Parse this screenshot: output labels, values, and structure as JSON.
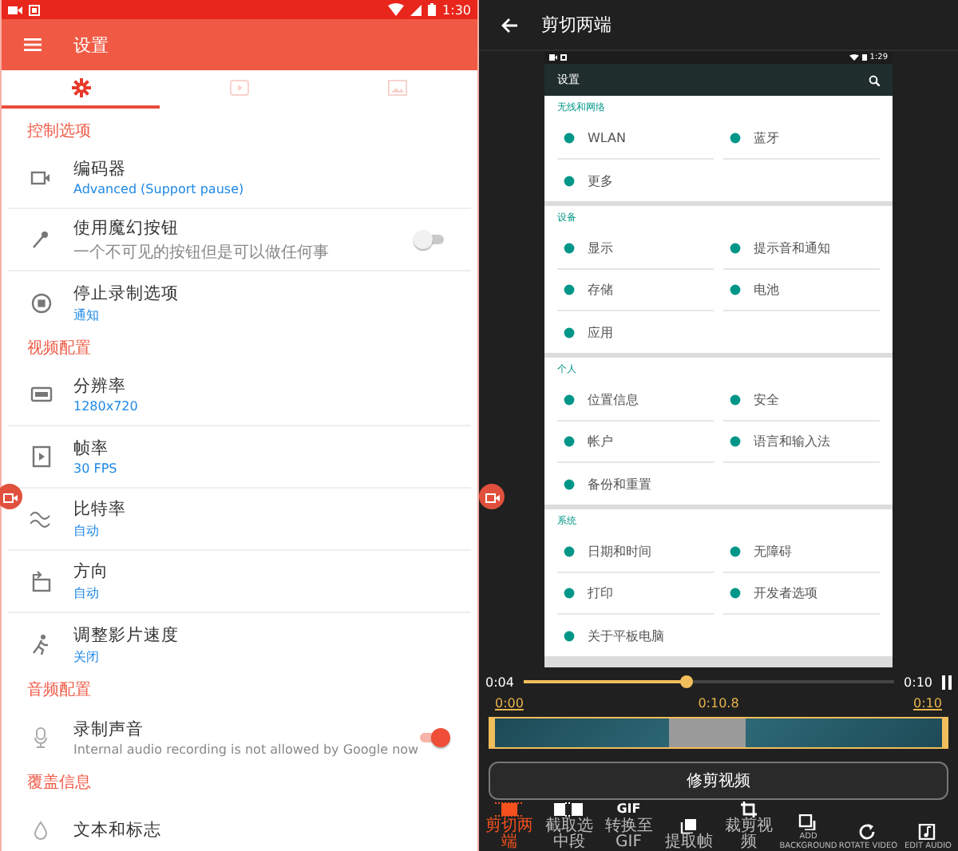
{
  "left_screen": {
    "status_bar": {
      "time": "1:30"
    },
    "app_bar": {
      "title": "设置"
    },
    "tabs": [
      {
        "selected": true
      },
      {
        "selected": false
      },
      {
        "selected": false
      }
    ],
    "sections": [
      {
        "header": "控制选项",
        "items": [
          {
            "kind": "value",
            "title": "编码器",
            "subtitle": "Advanced (Support pause)"
          },
          {
            "kind": "switch",
            "title": "使用魔幻按钮",
            "subtitle": "一个不可见的按钮但是可以做任何事",
            "on": false
          },
          {
            "kind": "value",
            "title": "停止录制选项",
            "subtitle": "通知"
          }
        ]
      },
      {
        "header": "视频配置",
        "items": [
          {
            "kind": "value",
            "title": "分辨率",
            "subtitle": "1280x720"
          },
          {
            "kind": "value",
            "title": "帧率",
            "subtitle": "30 FPS"
          },
          {
            "kind": "value",
            "title": "比特率",
            "subtitle": "自动"
          },
          {
            "kind": "value",
            "title": "方向",
            "subtitle": "自动"
          },
          {
            "kind": "value",
            "title": "调整影片速度",
            "subtitle": "关闭"
          }
        ]
      },
      {
        "header": "音频配置",
        "items": [
          {
            "kind": "switch",
            "title": "录制声音",
            "subtitle": "Internal audio recording is not allowed by Google now",
            "on": true
          }
        ]
      },
      {
        "header": "覆盖信息",
        "items": [
          {
            "kind": "value",
            "title": "文本和标志"
          }
        ]
      }
    ]
  },
  "editor": {
    "app_bar": {
      "title": "剪切两端"
    },
    "preview": {
      "status_bar": {
        "time": "1:29"
      },
      "title": "设置",
      "sections": [
        {
          "header": "无线和网络",
          "items": [
            "WLAN",
            "蓝牙",
            "更多"
          ]
        },
        {
          "header": "设备",
          "items": [
            "显示",
            "提示音和通知",
            "存储",
            "电池",
            "应用"
          ]
        },
        {
          "header": "个人",
          "items": [
            "位置信息",
            "安全",
            "帐户",
            "语言和输入法",
            "备份和重置"
          ]
        },
        {
          "header": "系统",
          "items": [
            "日期和时间",
            "无障碍",
            "打印",
            "开发者选项",
            "关于平板电脑"
          ]
        }
      ]
    },
    "player": {
      "current_time": "0:04",
      "duration": "0:10",
      "level": 0.44
    },
    "trim": {
      "start": "0:00",
      "selection": "0:10.8",
      "end": "0:10"
    },
    "action_button": "修剪视频",
    "tools": [
      {
        "label": "剪切两端",
        "selected": true
      },
      {
        "label": "截取选中段",
        "selected": false
      },
      {
        "label": "转换至GIF",
        "icon_text": "GIF",
        "selected": false
      },
      {
        "label": "提取帧",
        "selected": false
      },
      {
        "label": "裁剪视频",
        "selected": false
      },
      {
        "label": "ADD BACKGROUND",
        "selected": false
      },
      {
        "label": "ROTATE VIDEO",
        "selected": false
      },
      {
        "label": "EDIT AUDIO",
        "selected": false
      }
    ]
  }
}
